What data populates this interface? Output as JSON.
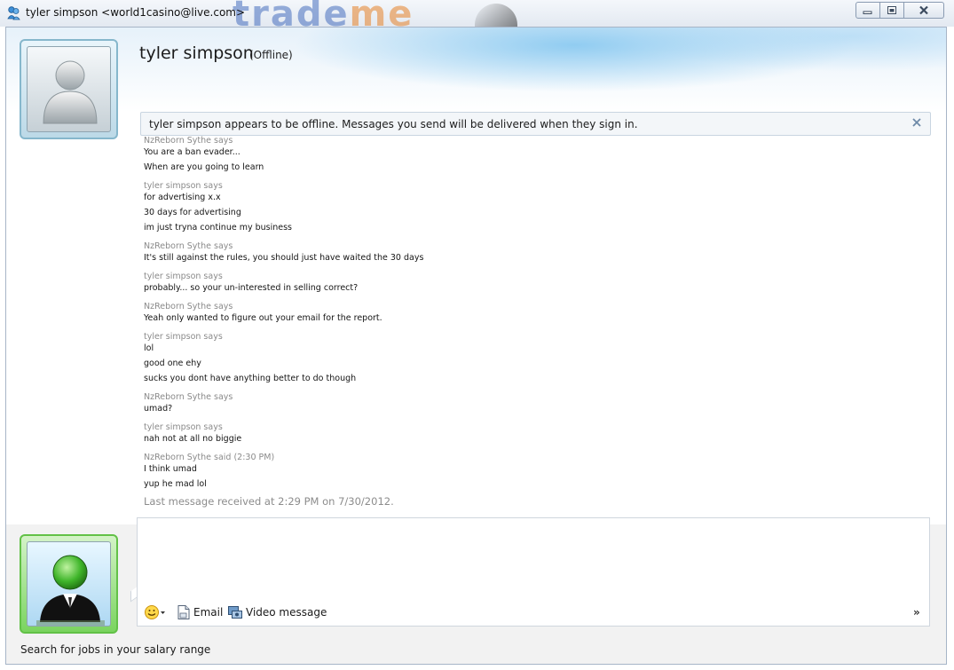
{
  "window": {
    "title": "tyler simpson <world1casino@live.com>",
    "background_logo": {
      "part1": "trade",
      "part2": "me"
    },
    "app_icon": "messenger-buddies-icon",
    "controls": {
      "minimize_icon": "minimize-icon",
      "restore_icon": "restore-icon",
      "close_icon": "close-icon"
    }
  },
  "contact": {
    "name": "tyler simpson",
    "status": "(Offline)",
    "avatar_icon": "default-user-avatar-icon"
  },
  "offline_notice": {
    "text": "tyler simpson appears to be offline. Messages you send will be delivered when they sign in.",
    "close_icon": "close-x-icon"
  },
  "conversation": [
    {
      "sender": "NzReborn Sythe says",
      "lines": [
        "You are a ban evader...",
        "When are you going to learn"
      ]
    },
    {
      "sender": "tyler simpson says",
      "lines": [
        "for advertising x.x",
        "30 days for advertising",
        "im just tryna continue my business"
      ]
    },
    {
      "sender": "NzReborn Sythe says",
      "lines": [
        "It's still against the rules, you should just have waited the 30 days"
      ]
    },
    {
      "sender": "tyler simpson says",
      "lines": [
        "probably... so your un-interested in selling correct?"
      ]
    },
    {
      "sender": "NzReborn Sythe says",
      "lines": [
        "Yeah only wanted to figure out your email for the report."
      ]
    },
    {
      "sender": "tyler simpson says",
      "lines": [
        "lol",
        "good one ehy",
        "sucks you dont have anything better to do though"
      ]
    },
    {
      "sender": "NzReborn Sythe says",
      "lines": [
        "umad?"
      ]
    },
    {
      "sender": "tyler simpson says",
      "lines": [
        "nah not at all no biggie"
      ]
    },
    {
      "sender": "NzReborn Sythe said (2:30 PM)",
      "lines": [
        "I think umad",
        "yup he mad lol"
      ]
    }
  ],
  "last_message": "Last message received at 2:29 PM on 7/30/2012.",
  "compose": {
    "input_value": "",
    "emoticon_icon": "smiley-face-icon",
    "email_label": "Email",
    "email_icon": "document-icon",
    "video_label": "Video message",
    "video_icon": "video-camera-icon",
    "more_label": "»"
  },
  "self": {
    "avatar_icon": "green-businessman-avatar-icon"
  },
  "ad_text": "Search for jobs in your salary range",
  "colors": {
    "offline_bar_bg": "#f3f6f9",
    "self_frame": "#62c147",
    "contact_frame": "#86b7cc",
    "sender_text": "#8a8a8a"
  }
}
